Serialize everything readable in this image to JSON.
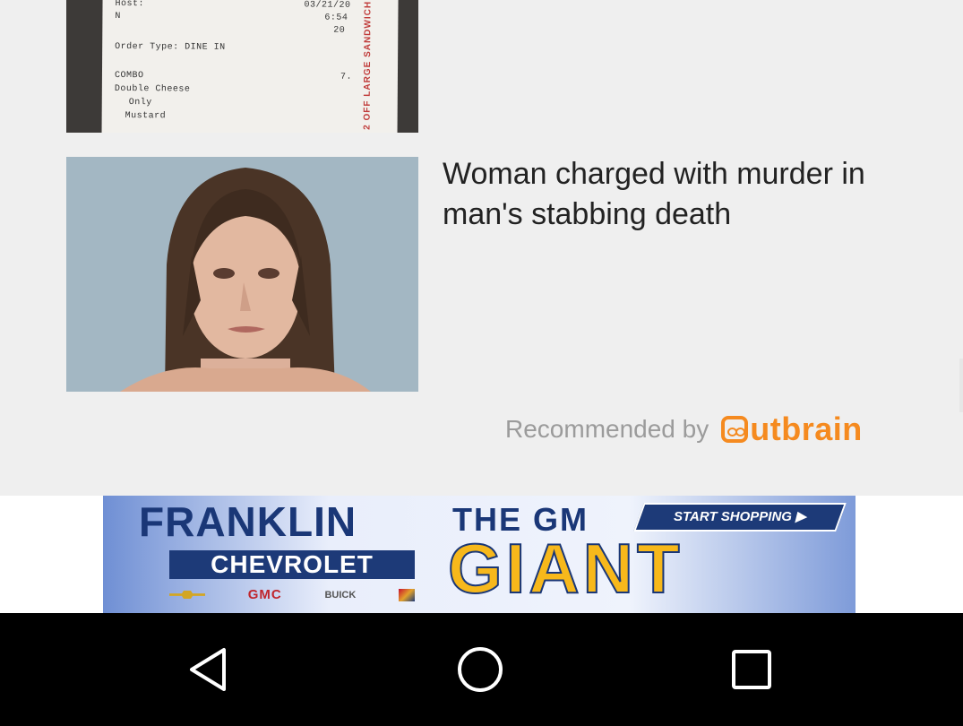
{
  "articles": [
    {
      "receipt": {
        "host": "Host:",
        "name": "N",
        "date": "03/21/20",
        "time": "6:54",
        "year": "20",
        "order_type": "Order Type:  DINE IN",
        "combo": "COMBO",
        "item1": "Double Cheese",
        "item2": "Only",
        "item3": "Mustard",
        "price": "7.",
        "stamp": "2 OFF LARGE SANDWICH"
      }
    },
    {
      "headline": "Woman charged with murder in man's stabbing death"
    }
  ],
  "recommendation": {
    "label": "Recommended by",
    "brand": "utbrain"
  },
  "ad": {
    "dealer": "FRANKLIN",
    "make": "CHEVROLET",
    "brands": [
      "CHEVROLET",
      "GMC",
      "BUICK",
      "CADILLAC"
    ],
    "tagline_top": "THE GM",
    "tagline_main": "GIANT",
    "cta": "START SHOPPING ▶"
  },
  "colors": {
    "outbrain": "#f58a1f",
    "dealer_blue": "#1a3777",
    "giant_yellow": "#f7b81b"
  },
  "nav": {
    "icons": [
      "back-icon",
      "home-icon",
      "recent-apps-icon"
    ]
  }
}
